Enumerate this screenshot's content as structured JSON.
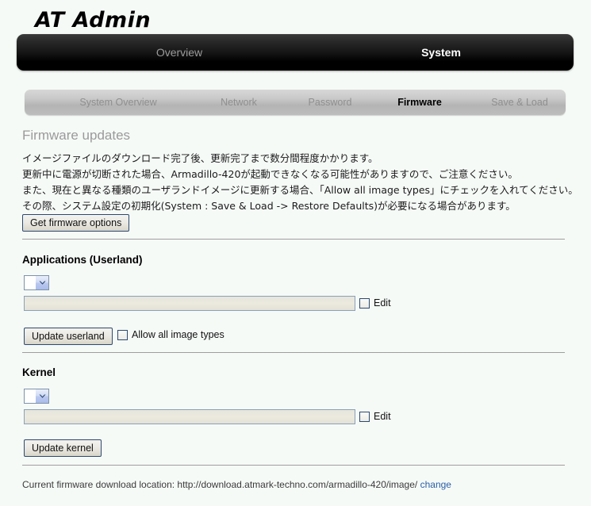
{
  "brand": {
    "title": "AT Admin"
  },
  "mainnav": {
    "items": [
      {
        "label": "Overview",
        "active": false
      },
      {
        "label": "System",
        "active": true
      }
    ]
  },
  "subnav": {
    "items": [
      {
        "label": "System Overview",
        "active": false
      },
      {
        "label": "Network",
        "active": false
      },
      {
        "label": "Password",
        "active": false
      },
      {
        "label": "Firmware",
        "active": true
      },
      {
        "label": "Save & Load",
        "active": false
      }
    ]
  },
  "firmware": {
    "heading": "Firmware updates",
    "description_lines": [
      "イメージファイルのダウンロード完了後、更新完了まで数分間程度かかります。",
      "更新中に電源が切断された場合、Armadillo-420が起動できなくなる可能性がありますので、ご注意ください。",
      "また、現在と異なる種類のユーザランドイメージに更新する場合、「Allow all image types」にチェックを入れてください。",
      "その際、システム設定の初期化(System : Save & Load -> Restore Defaults)が必要になる場合があります。"
    ],
    "get_options_button": "Get firmware options"
  },
  "userland": {
    "heading": "Applications (Userland)",
    "select_value": "",
    "image_path_value": "",
    "image_path_placeholder": "",
    "edit_label": "Edit",
    "edit_checked": false,
    "update_button": "Update userland",
    "allow_all_label": "Allow all image types",
    "allow_all_checked": false
  },
  "kernel": {
    "heading": "Kernel",
    "select_value": "",
    "image_path_value": "",
    "image_path_placeholder": "",
    "edit_label": "Edit",
    "edit_checked": false,
    "update_button": "Update kernel"
  },
  "footer": {
    "prefix": "Current firmware download location: http://download.atmark-techno.com/armadillo-420/image/",
    "link_label": "change"
  },
  "colors": {
    "page_background": "#f6faf7",
    "mainnav_background": "#000000",
    "subnav_background": "#c4c4c4",
    "active_text": "#000000",
    "inactive_text": "#8f8f8f",
    "heading_gray": "#9a9a9a",
    "link_blue": "#2a5fa8",
    "control_border_blue": "#2c4a72"
  }
}
